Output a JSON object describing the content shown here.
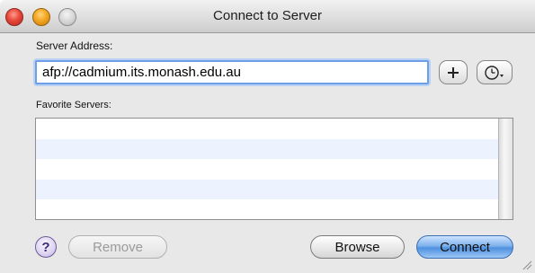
{
  "window": {
    "title": "Connect to Server"
  },
  "titlebar": {
    "buttons": [
      "close",
      "minimize",
      "zoom"
    ]
  },
  "server": {
    "address_label": "Server Address:",
    "address_value": "afp://cadmium.its.monash.edu.au",
    "add_icon": "plus-icon",
    "history_icon": "clock-icon"
  },
  "favorites": {
    "label": "Favorite Servers:",
    "items": []
  },
  "footer": {
    "help_label": "?",
    "remove_label": "Remove",
    "browse_label": "Browse",
    "connect_label": "Connect"
  },
  "colors": {
    "focus_ring": "#6e9ee8",
    "default_button": "#4f90e0",
    "list_alt_row": "#edf3fe"
  }
}
